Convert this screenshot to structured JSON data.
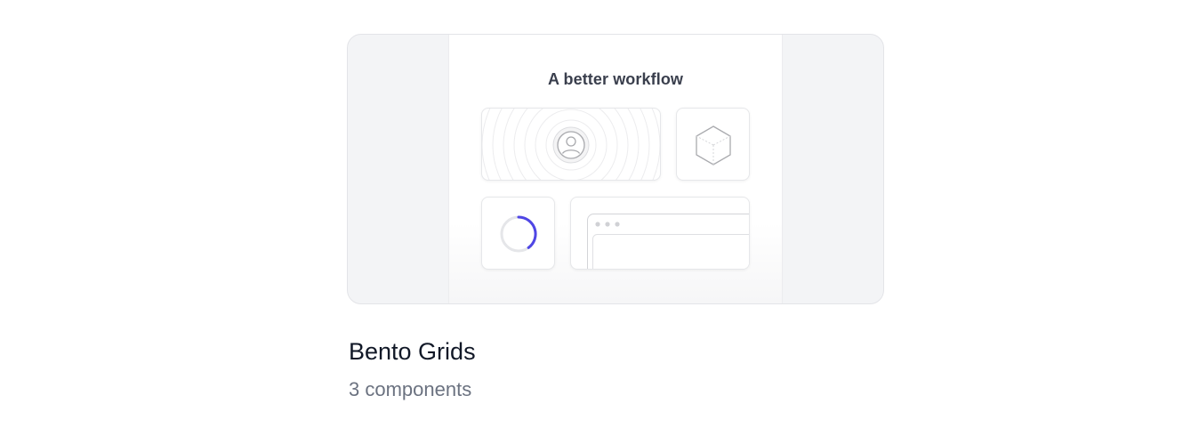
{
  "card": {
    "preview_title": "A better workflow",
    "title": "Bento Grids",
    "subtitle": "3 components"
  },
  "preview_icons": [
    "user-avatar-icon",
    "cube-icon",
    "loading-spinner-icon",
    "browser-window-icon"
  ],
  "colors": {
    "accent": "#4f46e5",
    "frame_bg": "#f3f4f6",
    "title": "#111827",
    "subtitle": "#6b7280"
  }
}
